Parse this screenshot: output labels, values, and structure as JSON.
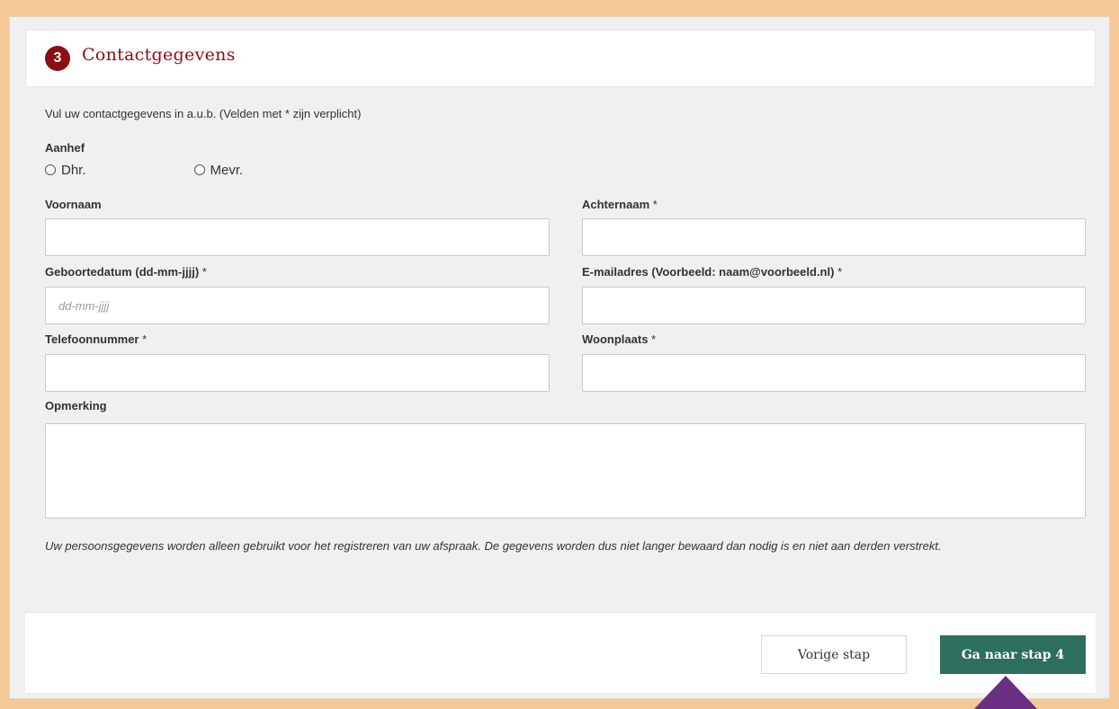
{
  "header": {
    "step_number": "3",
    "title": "Contactgegevens"
  },
  "intro": "Vul uw contactgegevens in a.u.b. (Velden met * zijn verplicht)",
  "salutation": {
    "label": "Aanhef",
    "options": [
      "Dhr.",
      "Mevr."
    ]
  },
  "fields": {
    "first_name": {
      "label": "Voornaam",
      "required": "",
      "value": "",
      "placeholder": ""
    },
    "last_name": {
      "label": "Achternaam",
      "required": " *",
      "value": "",
      "placeholder": ""
    },
    "birth_date": {
      "label": "Geboortedatum (dd-mm-jjjj)",
      "required": " *",
      "value": "",
      "placeholder": "dd-mm-jjjj"
    },
    "email": {
      "label": "E-mailadres (Voorbeeld: naam@voorbeeld.nl)",
      "required": " *",
      "value": "",
      "placeholder": ""
    },
    "phone": {
      "label": "Telefoonnummer",
      "required": " *",
      "value": "",
      "placeholder": ""
    },
    "city": {
      "label": "Woonplaats",
      "required": " *",
      "value": "",
      "placeholder": ""
    },
    "remark": {
      "label": "Opmerking",
      "value": ""
    }
  },
  "privacy_notice": "Uw persoonsgegevens worden alleen gebruikt voor het registreren van uw afspraak. De gegevens worden dus niet langer bewaard dan nodig is en niet aan derden verstrekt.",
  "footer": {
    "prev_label": "Vorige stap",
    "next_label": "Ga naar stap 4"
  },
  "colors": {
    "page_background": "#f5c896",
    "accent_red": "#8a0e14",
    "primary_button": "#2e6e5f",
    "pointer_arrow": "#6a2e82"
  }
}
